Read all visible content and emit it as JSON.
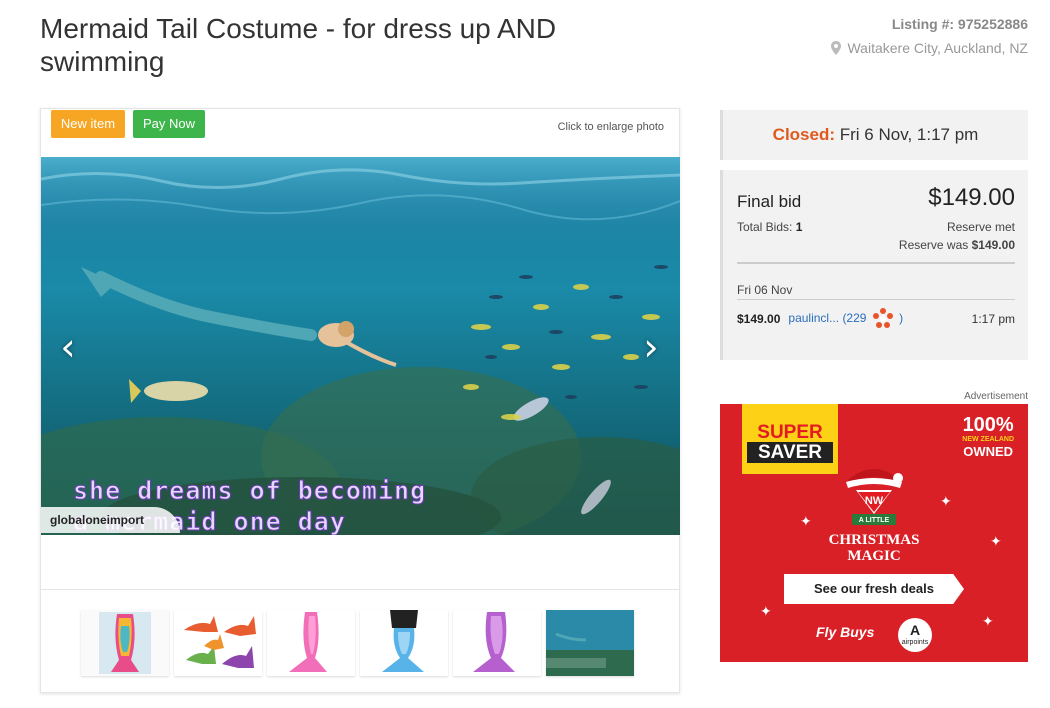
{
  "header": {
    "title": "Mermaid Tail Costume - for dress up AND swimming",
    "listing_label": "Listing #: 975252886",
    "location": "Waitakere City, Auckland, NZ"
  },
  "gallery": {
    "new_item_label": "New item",
    "pay_now_label": "Pay Now",
    "enlarge_hint": "Click to enlarge photo",
    "prev_arrow": "‹",
    "next_arrow": "›",
    "caption_line1": "she dreams of becoming",
    "caption_line2": "a mermaid one day",
    "watermark": "globaloneimport",
    "thumbnails": [
      {
        "name": "rainbow-tail"
      },
      {
        "name": "multi-tails"
      },
      {
        "name": "pink-tail"
      },
      {
        "name": "blue-tail"
      },
      {
        "name": "purple-tail"
      },
      {
        "name": "underwater-scene"
      }
    ]
  },
  "auction": {
    "closed_label": "Closed:",
    "closed_time": "Fri 6 Nov, 1:17 pm",
    "final_bid_label": "Final bid",
    "final_price": "$149.00",
    "total_bids_label": "Total Bids:",
    "total_bids_value": "1",
    "reserve_met": "Reserve met",
    "reserve_was_label": "Reserve was",
    "reserve_was_value": "$149.00",
    "history_date": "Fri 06 Nov",
    "history": [
      {
        "amount": "$149.00",
        "bidder": "paulincl...",
        "rating_open": "(229",
        "rating_close": ")",
        "time": "1:17 pm"
      }
    ]
  },
  "ad": {
    "label": "Advertisement",
    "super": "SUPER",
    "saver": "SAVER",
    "owned_pct": "100%",
    "owned_nz": "NEW ZEALAND",
    "owned_word": "OWNED",
    "brand": "NW",
    "tagline_small": "A LITTLE",
    "tagline1": "CHRISTMAS",
    "tagline2": "MAGIC",
    "cta": "See our fresh deals",
    "flybuys": "Fly Buys",
    "airpoints": "airpoints"
  },
  "colors": {
    "new_item": "#f6a623",
    "pay_now": "#3db54a",
    "closed": "#e05a1e",
    "link": "#2a6ebb",
    "ad_red": "#d92027",
    "ad_yellow": "#fcd116"
  }
}
